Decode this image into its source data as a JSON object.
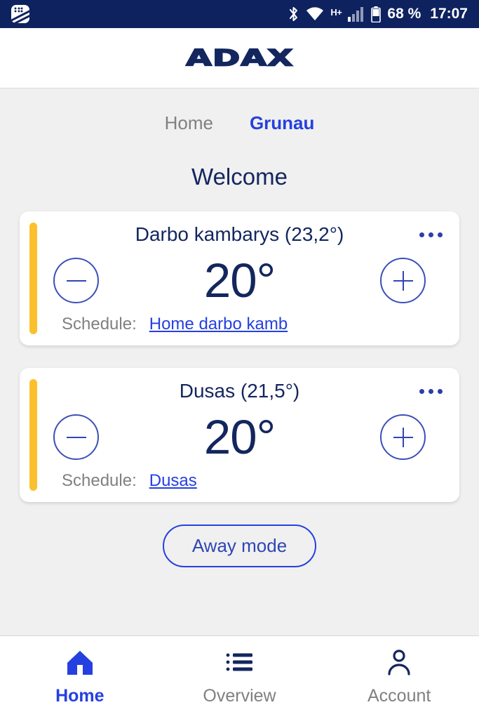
{
  "status_bar": {
    "app_icon": "blackberry-app-icon",
    "bluetooth_icon": "bluetooth-icon",
    "wifi_icon": "wifi-icon",
    "network_type": "H+",
    "signal_icon": "signal-bars-icon",
    "battery_icon": "battery-icon",
    "battery_level": "68 %",
    "time": "17:07",
    "background_color": "#0e2260"
  },
  "header": {
    "logo_text": "ADAX",
    "logo_color": "#13265e"
  },
  "tabs": [
    {
      "label": "Home",
      "active": false
    },
    {
      "label": "Grunau",
      "active": true
    }
  ],
  "page_title": "Welcome",
  "devices": [
    {
      "title": "Darbo kambarys (23,2°)",
      "current_temperature": "23,2°",
      "target_temperature": "20°",
      "decrease_label": "−",
      "increase_label": "+",
      "menu_icon": "more-horizontal-icon",
      "schedule_label": "Schedule:",
      "schedule_name": "Home darbo kamb",
      "accent_color": "#fbc02d"
    },
    {
      "title": "Dusas (21,5°)",
      "current_temperature": "21,5°",
      "target_temperature": "20°",
      "decrease_label": "−",
      "increase_label": "+",
      "menu_icon": "more-horizontal-icon",
      "schedule_label": "Schedule:",
      "schedule_name": "Dusas",
      "accent_color": "#fbc02d"
    }
  ],
  "away_mode_label": "Away mode",
  "bottom_nav": [
    {
      "label": "Home",
      "icon": "home-icon",
      "active": true
    },
    {
      "label": "Overview",
      "icon": "list-icon",
      "active": false
    },
    {
      "label": "Account",
      "icon": "person-icon",
      "active": false
    }
  ],
  "colors": {
    "brand_navy": "#13265e",
    "accent_blue": "#2540e0",
    "accent_yellow": "#fbc02d",
    "page_background": "#f0f0f0"
  }
}
